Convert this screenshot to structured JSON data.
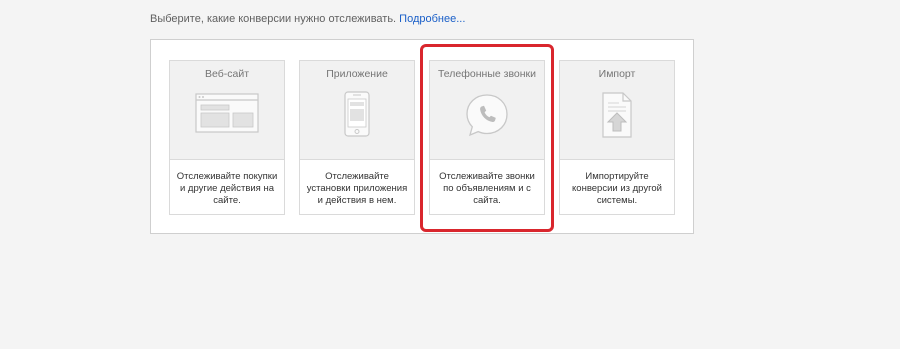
{
  "intro": {
    "text": "Выберите, какие конверсии нужно отслеживать.",
    "link": "Подробнее..."
  },
  "cards": [
    {
      "title": "Веб-сайт",
      "description": "Отслеживайте покупки и другие действия на сайте.",
      "icon": "website-icon"
    },
    {
      "title": "Приложение",
      "description": "Отслеживайте установки приложения и действия в нем.",
      "icon": "mobile-app-icon"
    },
    {
      "title": "Телефонные звонки",
      "description": "Отслеживайте звонки по объявлениям и с сайта.",
      "icon": "phone-call-icon",
      "highlighted": true
    },
    {
      "title": "Импорт",
      "description": "Импортируйте конверсии из другой системы.",
      "icon": "import-file-icon"
    }
  ],
  "colors": {
    "page_background": "#f4f4f4",
    "link": "#1a5fc8",
    "highlight": "#d9262d",
    "card_top": "#f1f1f1"
  }
}
